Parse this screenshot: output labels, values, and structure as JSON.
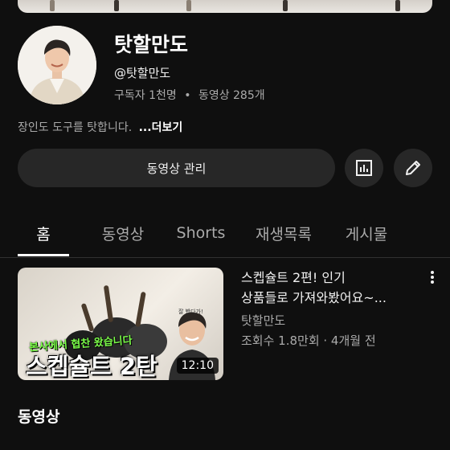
{
  "channel": {
    "name": "탓할만도",
    "handle": "@탓할만도",
    "subscribers": "구독자 1천명",
    "stats_separator": "•",
    "videos_count": "동영상 285개",
    "description": "장인도 도구를 탓합니다.",
    "more_label": "...더보기"
  },
  "actions": {
    "manage_videos_label": "동영상 관리",
    "analytics_icon": "bar-chart-icon",
    "edit_icon": "pencil-icon"
  },
  "tabs": [
    {
      "label": "홈",
      "active": true
    },
    {
      "label": "동영상",
      "active": false
    },
    {
      "label": "Shorts",
      "active": false
    },
    {
      "label": "재생목록",
      "active": false
    },
    {
      "label": "게시물",
      "active": false
    }
  ],
  "featured_video": {
    "title_line1": "스켑슐트 2편! 인기",
    "title_line2": "상품들로 가져와봤어요~...",
    "channel": "탓할만도",
    "meta": "조회수 1.8만회 · 4개월 전",
    "duration": "12:10",
    "thumb_subtitle": "본사에서 협찬 왔습니다",
    "thumb_title": "스켑슐트 2탄",
    "thumb_small_text": "잘 봤다가!"
  },
  "sections": {
    "videos_heading": "동영상"
  },
  "colors": {
    "background": "#0f0f0f",
    "button_bg": "#272727",
    "secondary_text": "#aaaaaa",
    "primary_text": "#f1f1f1"
  }
}
